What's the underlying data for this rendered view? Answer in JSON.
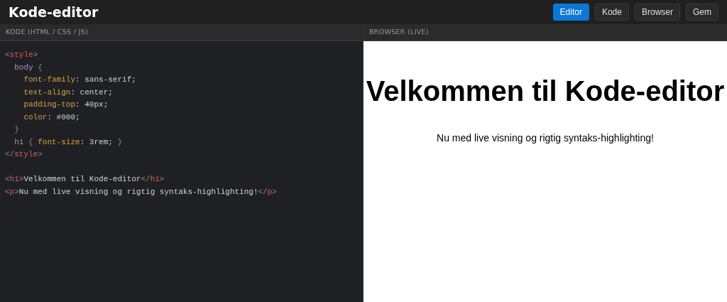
{
  "app": {
    "title": "Kode-editor"
  },
  "toolbar": [
    {
      "label": "Editor",
      "selected": true
    },
    {
      "label": "Kode",
      "selected": false
    },
    {
      "label": "Browser",
      "selected": false
    },
    {
      "label": "Gem",
      "selected": false
    }
  ],
  "code_panel": {
    "header": "KODE (HTML / CSS / JS)",
    "lines": [
      {
        "tokens": [
          {
            "kind": "punct",
            "text": "<"
          },
          {
            "kind": "tag",
            "text": "style"
          },
          {
            "kind": "punct",
            "text": ">"
          }
        ]
      },
      {
        "tokens": [
          {
            "kind": "selector",
            "text": "  body"
          },
          {
            "kind": "punct",
            "text": " {"
          }
        ]
      },
      {
        "tokens": [
          {
            "kind": "prop",
            "text": "    font-family"
          },
          {
            "kind": "plain",
            "text": ": sans-serif;"
          }
        ]
      },
      {
        "tokens": [
          {
            "kind": "prop",
            "text": "    text-align"
          },
          {
            "kind": "plain",
            "text": ": center;"
          }
        ]
      },
      {
        "tokens": [
          {
            "kind": "prop",
            "text": "    padding-top"
          },
          {
            "kind": "plain",
            "text": ": 40px;"
          }
        ]
      },
      {
        "tokens": [
          {
            "kind": "prop",
            "text": "    color"
          },
          {
            "kind": "plain",
            "text": ": #000;"
          }
        ]
      },
      {
        "tokens": [
          {
            "kind": "punct",
            "text": "  }"
          }
        ]
      },
      {
        "tokens": [
          {
            "kind": "selector",
            "text": "  h1"
          },
          {
            "kind": "punct",
            "text": " { "
          },
          {
            "kind": "prop",
            "text": "font-size"
          },
          {
            "kind": "plain",
            "text": ": 3rem; "
          },
          {
            "kind": "punct",
            "text": "}"
          }
        ]
      },
      {
        "tokens": [
          {
            "kind": "punct",
            "text": "</"
          },
          {
            "kind": "tag",
            "text": "style"
          },
          {
            "kind": "punct",
            "text": ">"
          }
        ]
      },
      {
        "gap_before": true,
        "tokens": [
          {
            "kind": "punct",
            "text": "<"
          },
          {
            "kind": "tag",
            "text": "h1"
          },
          {
            "kind": "punct",
            "text": ">"
          },
          {
            "kind": "plain",
            "text": "Velkommen til Kode-editor"
          },
          {
            "kind": "punct",
            "text": "</"
          },
          {
            "kind": "tag",
            "text": "h1"
          },
          {
            "kind": "punct",
            "text": ">"
          }
        ]
      },
      {
        "tokens": [
          {
            "kind": "punct",
            "text": "<"
          },
          {
            "kind": "tag",
            "text": "p"
          },
          {
            "kind": "punct",
            "text": ">"
          },
          {
            "kind": "plain",
            "text": "Nu med live visning og rigtig syntaks-highlighting!"
          },
          {
            "kind": "punct",
            "text": "</"
          },
          {
            "kind": "tag",
            "text": "p"
          },
          {
            "kind": "punct",
            "text": ">"
          }
        ]
      }
    ]
  },
  "browser_panel": {
    "header": "BROWSER (LIVE)",
    "heading": "Velkommen til Kode-editor",
    "paragraph": "Nu med live visning og rigtig syntaks-highlighting!"
  }
}
